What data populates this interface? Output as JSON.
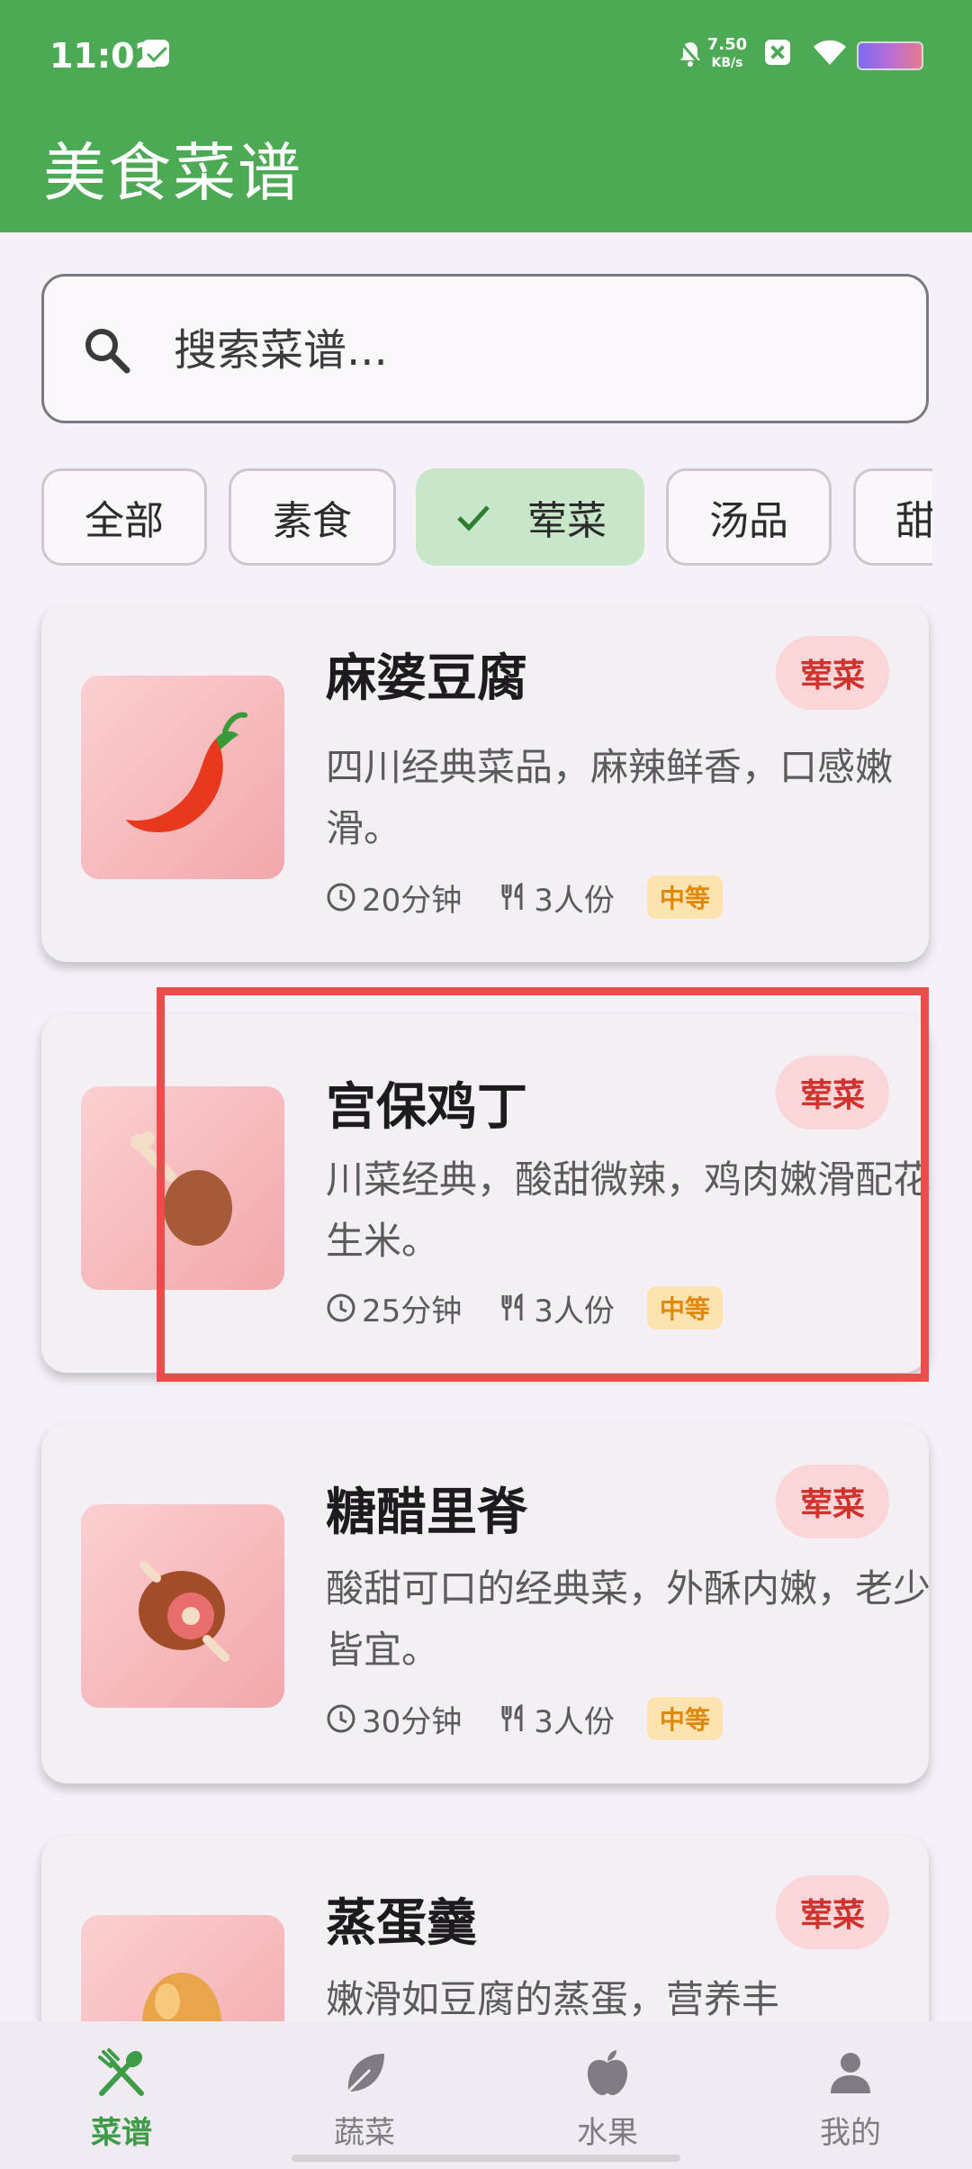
{
  "status_bar": {
    "time": "11:02",
    "net_speed_value": "7.50",
    "net_speed_unit": "KB/s"
  },
  "app_bar": {
    "title": "美食菜谱"
  },
  "search": {
    "placeholder": "搜索菜谱..."
  },
  "categories": [
    {
      "label": "全部",
      "selected": false
    },
    {
      "label": "素食",
      "selected": false
    },
    {
      "label": "荤菜",
      "selected": true
    },
    {
      "label": "汤品",
      "selected": false
    },
    {
      "label": "甜",
      "selected": false
    }
  ],
  "recipes": [
    {
      "name": "麻婆豆腐",
      "tag": "荤菜",
      "desc": "四川经典菜品，麻辣鲜香，口感嫩滑。",
      "time": "20分钟",
      "servings": "3人份",
      "difficulty": "中等",
      "icon": "chili-pepper-icon"
    },
    {
      "name": "宫保鸡丁",
      "tag": "荤菜",
      "desc": "川菜经典，酸甜微辣，鸡肉嫩滑配花生米。",
      "time": "25分钟",
      "servings": "3人份",
      "difficulty": "中等",
      "icon": "chicken-leg-icon"
    },
    {
      "name": "糖醋里脊",
      "tag": "荤菜",
      "desc": "酸甜可口的经典菜，外酥内嫩，老少皆宜。",
      "time": "30分钟",
      "servings": "3人份",
      "difficulty": "中等",
      "icon": "meat-on-bone-icon"
    },
    {
      "name": "蒸蛋羹",
      "tag": "荤菜",
      "desc": "嫩滑如豆腐的蒸蛋，营养丰",
      "icon": "egg-icon"
    }
  ],
  "bottom_nav": [
    {
      "label": "菜谱",
      "active": true,
      "icon": "fork-spoon-icon"
    },
    {
      "label": "蔬菜",
      "active": false,
      "icon": "leaf-icon"
    },
    {
      "label": "水果",
      "active": false,
      "icon": "apple-icon"
    },
    {
      "label": "我的",
      "active": false,
      "icon": "person-icon"
    }
  ],
  "colors": {
    "primary": "#4caa55",
    "tag_bg": "#fbd6d8",
    "tag_text": "#d0322d",
    "difficulty_bg": "#fde3b0",
    "difficulty_text": "#e0880c",
    "highlight": "#ec4c4a"
  }
}
